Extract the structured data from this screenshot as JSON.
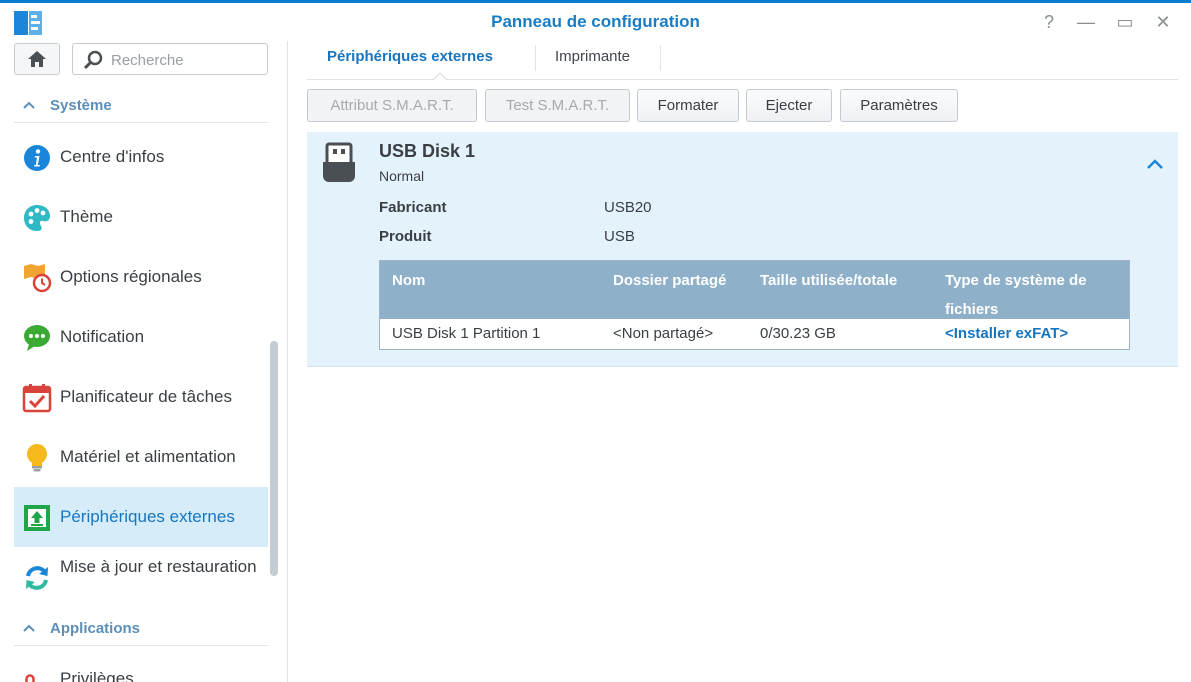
{
  "window": {
    "title": "Panneau de configuration",
    "buttons": {
      "help": "?",
      "minimize": "—",
      "maximize": "▭",
      "close": "✕"
    }
  },
  "sidebar": {
    "search_placeholder": "Recherche",
    "section_system": "Système",
    "section_apps": "Applications",
    "items": [
      {
        "label": "Centre d'infos",
        "icon": "info-icon",
        "color": "#1a86d9"
      },
      {
        "label": "Thème",
        "icon": "palette-icon",
        "color": "#2fb9c5"
      },
      {
        "label": "Options régionales",
        "icon": "regional-clock-icon",
        "color": "#f0a531"
      },
      {
        "label": "Notification",
        "icon": "chat-bubble-icon",
        "color": "#3aaa35"
      },
      {
        "label": "Planificateur de tâches",
        "icon": "calendar-check-icon",
        "color": "#d9433b"
      },
      {
        "label": "Matériel et alimentation",
        "icon": "lightbulb-icon",
        "color": "#f5b91c"
      },
      {
        "label": "Périphériques externes",
        "icon": "upload-device-icon",
        "color": "#1fa54a"
      },
      {
        "label": "Mise à jour et restauration",
        "icon": "refresh-icon",
        "color": "#1a86d9"
      },
      {
        "label": "Privilèges",
        "icon": "privileges-icon",
        "color": "#d9433b"
      }
    ]
  },
  "tabs": [
    {
      "label": "Périphériques externes"
    },
    {
      "label": "Imprimante"
    }
  ],
  "toolbar": {
    "smart_attr": "Attribut S.M.A.R.T.",
    "smart_test": "Test S.M.A.R.T.",
    "format": "Formater",
    "eject": "Ejecter",
    "settings": "Paramètres"
  },
  "device": {
    "name": "USB Disk 1",
    "status": "Normal",
    "manufacturer_label": "Fabricant",
    "manufacturer_value": "USB20",
    "product_label": "Produit",
    "product_value": "USB"
  },
  "partition_table": {
    "headers": [
      "Nom",
      "Dossier partagé",
      "Taille utilisée/totale",
      "Type de système de fichiers"
    ],
    "rows": [
      [
        "USB Disk 1 Partition 1",
        "<Non partagé>",
        "0/30.23 GB",
        "<Installer exFAT>"
      ]
    ]
  },
  "colors": {
    "accent": "#1776bf",
    "active_bg": "#d6ecf9",
    "panel_bg": "#e4f2fc",
    "table_header": "#8eb0c9"
  }
}
